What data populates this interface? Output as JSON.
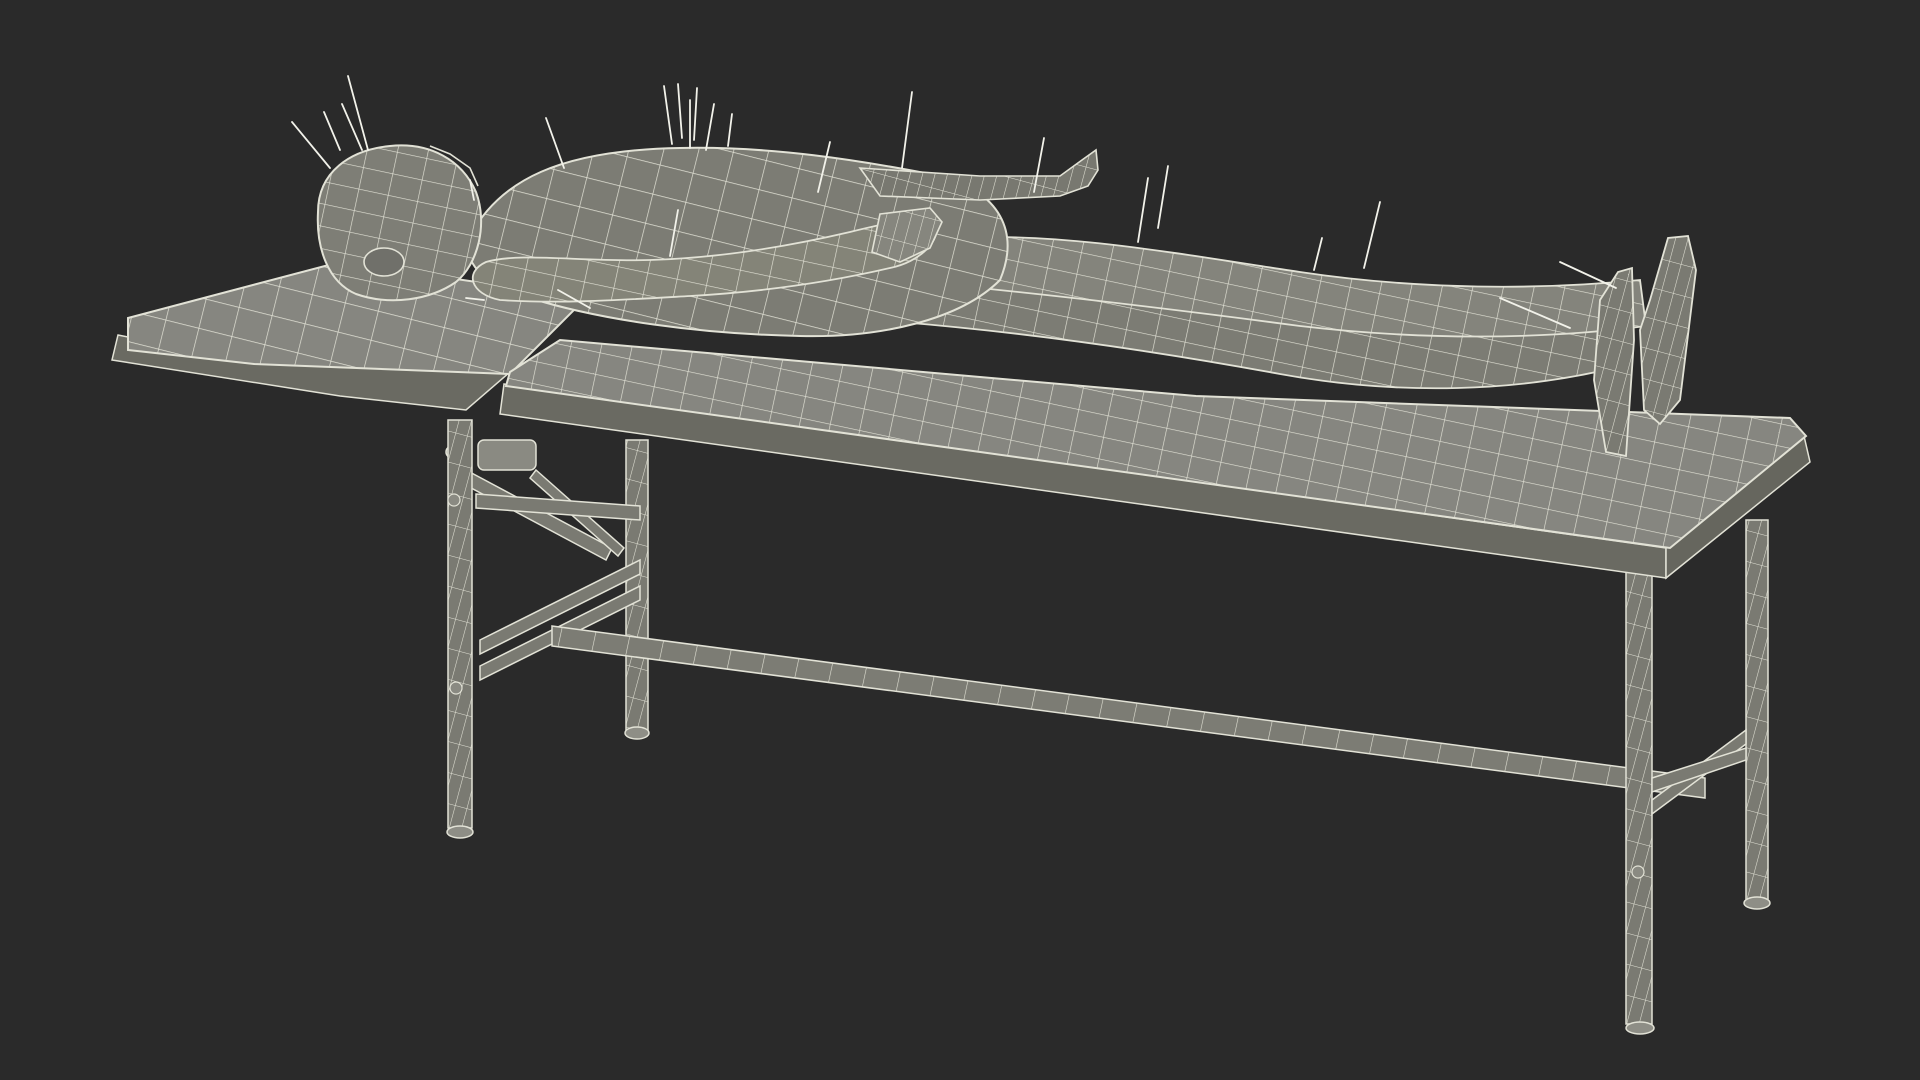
{
  "scene": {
    "subject": "acupuncture-model-on-massage-table",
    "render_style": "wireframe",
    "colors": {
      "background": "#2a2a2a",
      "surface": "#808078",
      "surface_dark": "#6a6a62",
      "surface_light": "#8e8e86",
      "wire": "#e2e2d6",
      "needle": "#f2f2ea",
      "shadow": "#202020"
    },
    "icons": {
      "needle": "acupuncture-needle-icon"
    },
    "needle_count": 24
  }
}
